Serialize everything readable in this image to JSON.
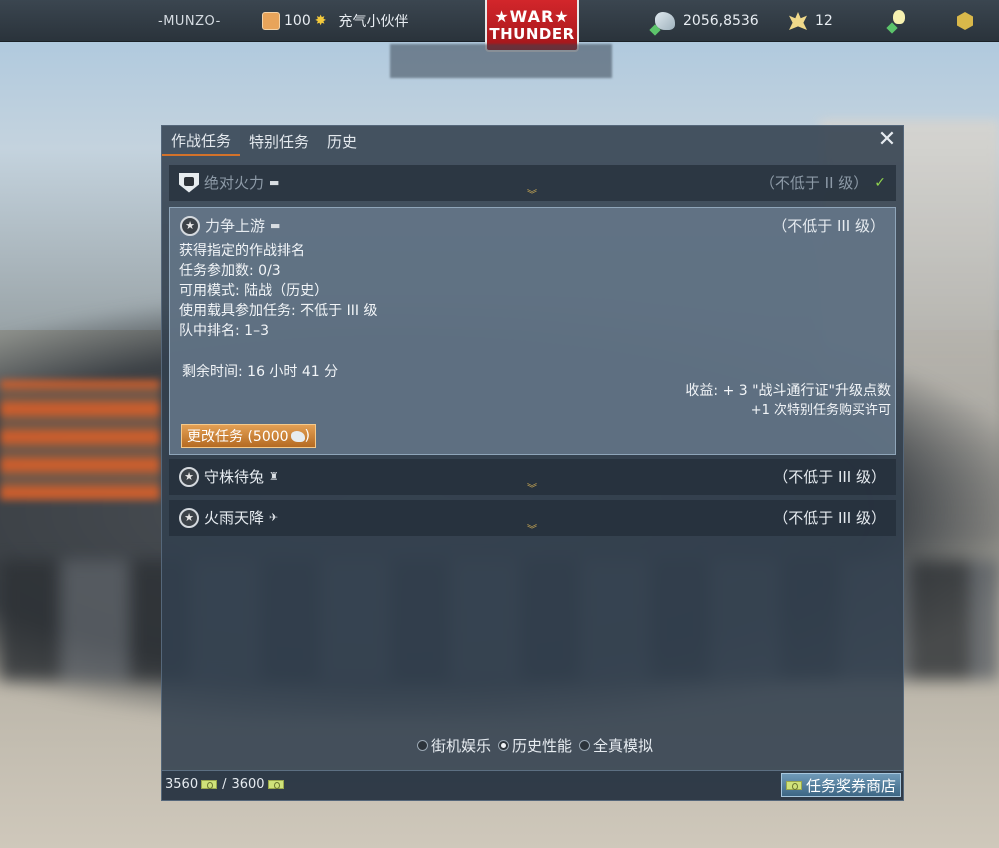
{
  "topbar": {
    "username": "-MUNZO-",
    "level": "100",
    "title": "充气小伙伴",
    "logo_line1": "★WAR★",
    "logo_line2": "THUNDER",
    "lions": "2056,8536",
    "eagles": "12"
  },
  "panel": {
    "tabs": [
      {
        "label": "作战任务",
        "active": true
      },
      {
        "label": "特别任务",
        "active": false
      },
      {
        "label": "历史",
        "active": false
      }
    ],
    "close_symbol": "✕"
  },
  "tasks": [
    {
      "name": "绝对火力",
      "vehicle_icon": "tank-icon",
      "vehicle_glyph": "▬",
      "requirement": "（不低于 II 级）",
      "completed": true,
      "check_glyph": "✓"
    },
    {
      "name": "力争上游",
      "vehicle_icon": "tank-icon",
      "vehicle_glyph": "▬",
      "requirement": "（不低于 III 级）",
      "expanded": true,
      "description": [
        "获得指定的作战排名",
        "任务参加数: 0/3",
        "可用模式: 陆战（历史）",
        "使用载具参加任务: 不低于 III 级",
        "队中排名: 1–3"
      ],
      "time_left": "剩余时间: 16 小时 41 分",
      "reward_line1": "收益: + 3 \"战斗通行证\"升级点数",
      "reward_line2": "+1 次特别任务购买许可",
      "change_button": "更改任务 (5000"
    },
    {
      "name": "守株待兔",
      "vehicle_icon": "spg-icon",
      "vehicle_glyph": "♜",
      "requirement": "（不低于 III 级）"
    },
    {
      "name": "火雨天降",
      "vehicle_icon": "plane-icon",
      "vehicle_glyph": "✈",
      "requirement": "（不低于 III 级）"
    }
  ],
  "chevron_glyph": "︾",
  "modes": [
    {
      "label": "街机娱乐",
      "selected": false
    },
    {
      "label": "历史性能",
      "selected": true
    },
    {
      "label": "全真模拟",
      "selected": false
    }
  ],
  "footer": {
    "current": "3560",
    "max": "3600",
    "slash": "/",
    "shop_label": "任务奖券商店"
  },
  "colors": {
    "accent_tab": "#d3722a",
    "button_orange": "#d08a3c",
    "check_green": "#8fd34e",
    "shop_blue": "#4f7a99"
  }
}
